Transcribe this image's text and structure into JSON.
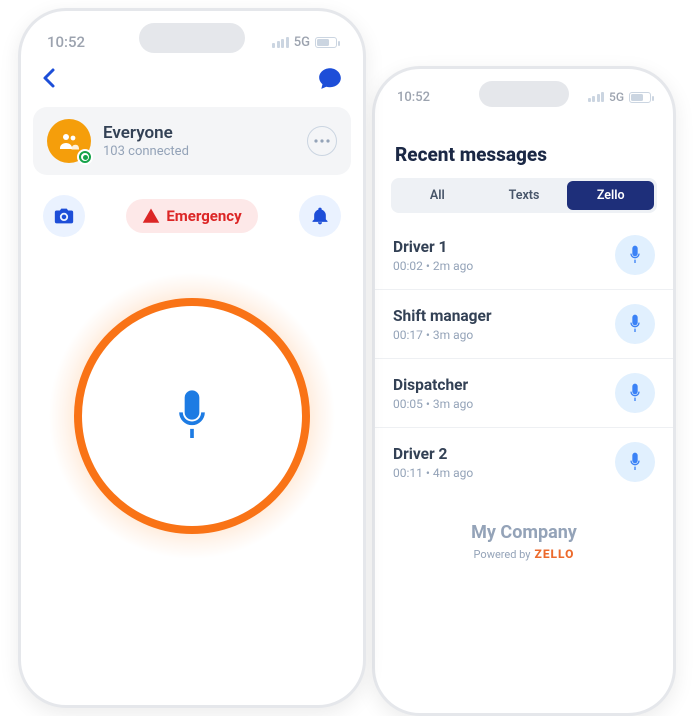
{
  "status": {
    "time": "10:52",
    "network": "5G"
  },
  "left": {
    "channel": {
      "name": "Everyone",
      "subtitle": "103 connected"
    },
    "emergency_label": "Emergency"
  },
  "right": {
    "title": "Recent messages",
    "tabs": {
      "all": "All",
      "texts": "Texts",
      "zello": "Zello"
    },
    "messages": [
      {
        "name": "Driver 1",
        "meta": "00:02 • 2m ago"
      },
      {
        "name": "Shift manager",
        "meta": "00:17 • 3m ago"
      },
      {
        "name": "Dispatcher",
        "meta": "00:05 • 3m ago"
      },
      {
        "name": "Driver 2",
        "meta": "00:11 • 4m ago"
      }
    ],
    "company": "My Company",
    "powered_by": "Powered by",
    "brand": "ZELLO"
  }
}
